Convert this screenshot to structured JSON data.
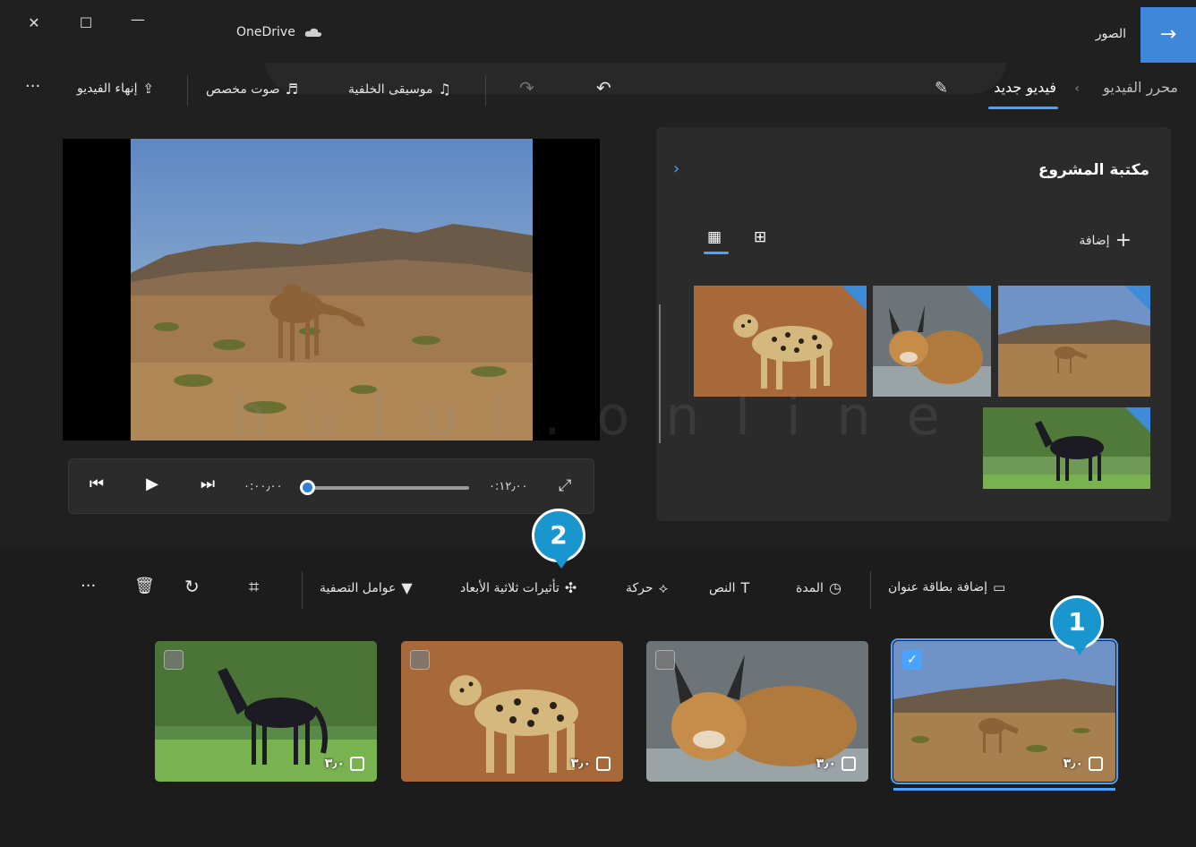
{
  "titlebar": {
    "app_name": "الصور",
    "cloud_label": "OneDrive",
    "close_glyph": "✕",
    "maximize_glyph": "☐",
    "minimize_glyph": "—",
    "back_glyph": "→"
  },
  "breadcrumb": {
    "root": "محرر الفيديو",
    "separator": "‹",
    "current": "فيديو جديد"
  },
  "toolbar": {
    "background_music": "موسيقى الخلفية",
    "custom_audio": "صوت مخصص",
    "finish_video": "إنهاء الفيديو",
    "more": "···",
    "undo_glyph": "↶",
    "redo_glyph": "↷",
    "edit_glyph": "✎"
  },
  "player": {
    "current_time": "٠:٠٠٫٠٠",
    "total_time": "٠:١٢٫٠٠",
    "progress": 0
  },
  "library": {
    "title": "مكتبة المشروع",
    "add_label": "إضافة",
    "add_glyph": "+",
    "collapse_glyph": "›",
    "grid_small_glyph": "▦",
    "grid_large_glyph": "⊞",
    "items": [
      "camel",
      "caracal",
      "leopard",
      "horse"
    ]
  },
  "storyboard": {
    "add_title_card": "إضافة بطاقة عنوان",
    "duration": "المدة",
    "text": "النص",
    "motion": "حركة",
    "effects_3d": "تأثيرات ثلاثية الأبعاد",
    "filters": "عوامل التصفية",
    "more": "···",
    "cards": [
      {
        "subject": "camel",
        "duration": "٣٫٠",
        "selected": true
      },
      {
        "subject": "caracal",
        "duration": "٣٫٠",
        "selected": false
      },
      {
        "subject": "leopard",
        "duration": "٣٫٠",
        "selected": false
      },
      {
        "subject": "horse",
        "duration": "٣٫٠",
        "selected": false
      }
    ]
  },
  "markers": [
    "1",
    "2"
  ],
  "watermark": "hülul.online",
  "colors": {
    "accent": "#4aa3ff",
    "back_button": "#3e87d9",
    "marker": "#1a96cf",
    "background": "#202020",
    "panel": "#2b2b2b"
  }
}
